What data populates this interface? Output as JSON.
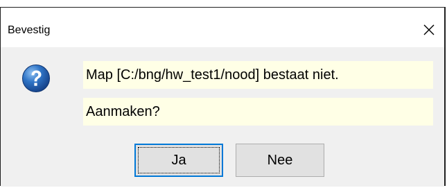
{
  "window": {
    "title": "Bevestig"
  },
  "icons": {
    "close": "close-icon",
    "message": "question-icon"
  },
  "message": {
    "line1": "Map [C:/bng/hw_test1/nood] bestaat niet.",
    "line2": "Aanmaken?"
  },
  "buttons": {
    "yes_label": "Ja",
    "no_label": "Nee"
  },
  "colors": {
    "accent": "#0078d7",
    "message_highlight": "#ffffe6",
    "dialog_background": "#f0f0f0"
  }
}
